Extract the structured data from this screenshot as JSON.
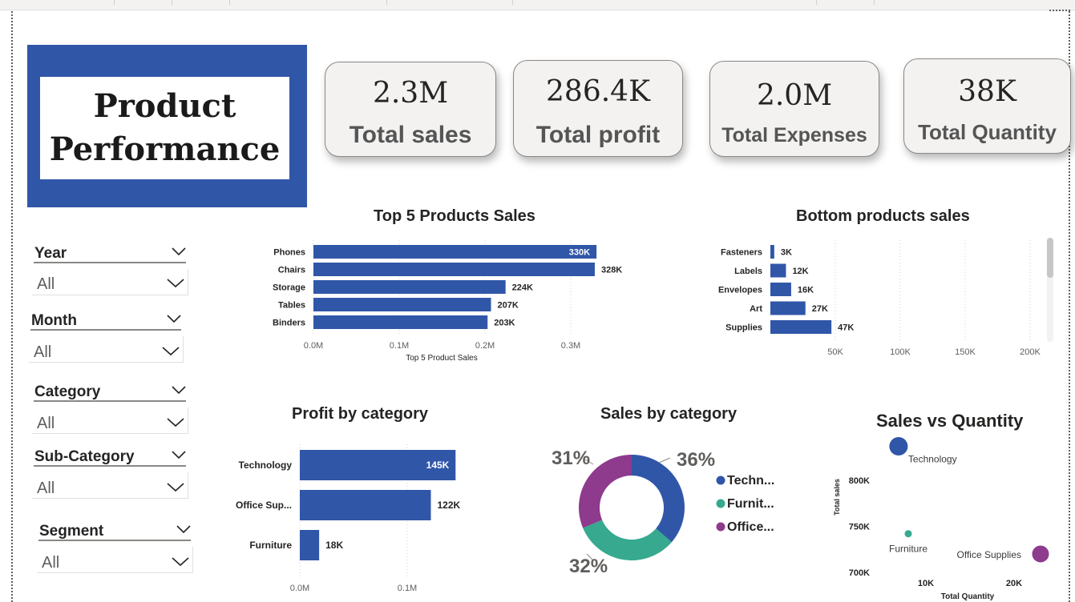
{
  "title": {
    "line1": "Product",
    "line2": "Performance"
  },
  "kpis": [
    {
      "value": "2.3M",
      "label": "Total sales"
    },
    {
      "value": "286.4K",
      "label": "Total profit"
    },
    {
      "value": "2.0M",
      "label": "Total Expenses"
    },
    {
      "value": "38K",
      "label": "Total Quantity"
    }
  ],
  "slicers": [
    {
      "label": "Year",
      "value": "All"
    },
    {
      "label": "Month",
      "value": "All"
    },
    {
      "label": "Category",
      "value": "All"
    },
    {
      "label": "Sub-Category",
      "value": "All"
    },
    {
      "label": "Segment",
      "value": "All"
    }
  ],
  "colors": {
    "accent": "#3056a8",
    "technology": "#3056a8",
    "furniture": "#36a98f",
    "office_supplies": "#8e3a8d"
  },
  "chart_data": [
    {
      "type": "bar",
      "orientation": "horizontal",
      "title": "Top 5 Products Sales",
      "categories": [
        "Phones",
        "Chairs",
        "Storage",
        "Tables",
        "Binders"
      ],
      "values": [
        330000,
        328000,
        224000,
        207000,
        203000
      ],
      "data_labels": [
        "330K",
        "328K",
        "224K",
        "207K",
        "203K"
      ],
      "xlabel": "Top 5 Product Sales",
      "xticks": [
        "0.0M",
        "0.1M",
        "0.2M",
        "0.3M"
      ],
      "xlim": [
        0,
        350000
      ]
    },
    {
      "type": "bar",
      "orientation": "horizontal",
      "title": "Bottom products sales",
      "categories": [
        "Fasteners",
        "Labels",
        "Envelopes",
        "Art",
        "Supplies"
      ],
      "values": [
        3000,
        12000,
        16000,
        27000,
        47000
      ],
      "data_labels": [
        "3K",
        "12K",
        "16K",
        "27K",
        "47K"
      ],
      "xticks": [
        "50K",
        "100K",
        "150K",
        "200K"
      ],
      "xlim": [
        0,
        210000
      ]
    },
    {
      "type": "bar",
      "orientation": "horizontal",
      "title": "Profit by category",
      "categories": [
        "Technology",
        "Office Sup...",
        "Furniture"
      ],
      "values": [
        145000,
        122000,
        18000
      ],
      "data_labels": [
        "145K",
        "122K",
        "18K"
      ],
      "xticks": [
        "0.0M",
        "0.1M"
      ],
      "xlim": [
        0,
        170000
      ]
    },
    {
      "type": "pie",
      "donut": true,
      "title": "Sales by category",
      "labels": [
        "Techn...",
        "Furnit...",
        "Office..."
      ],
      "values": [
        36,
        32,
        31
      ],
      "data_labels": [
        "36%",
        "32%",
        "31%"
      ],
      "legend": "right"
    },
    {
      "type": "scatter",
      "title": "Sales vs Quantity",
      "xlabel": "Total Quantity",
      "ylabel": "Total sales",
      "points": [
        {
          "name": "Technology",
          "x": 6900,
          "y": 837000
        },
        {
          "name": "Furniture",
          "x": 8000,
          "y": 742000
        },
        {
          "name": "Office Supplies",
          "x": 23000,
          "y": 720000
        }
      ],
      "xticks": [
        "10K",
        "20K"
      ],
      "yticks": [
        "800K",
        "750K",
        "700K"
      ],
      "xlim": [
        0,
        26000
      ],
      "ylim": [
        690000,
        850000
      ]
    }
  ]
}
